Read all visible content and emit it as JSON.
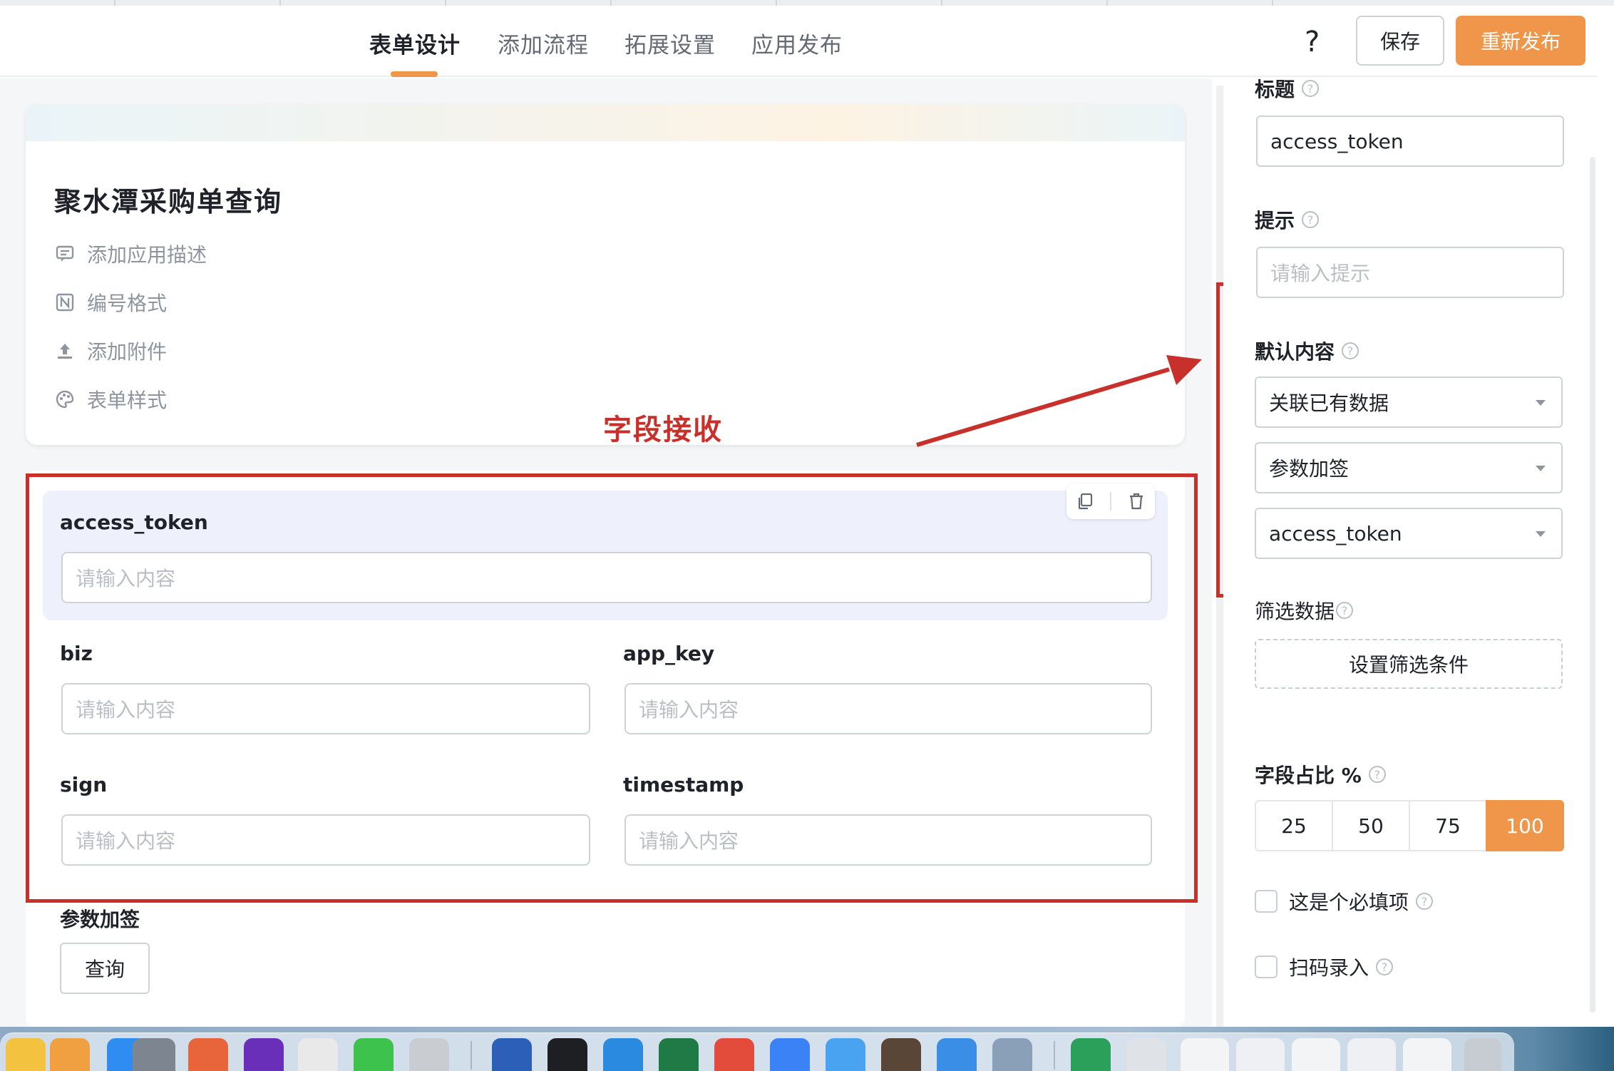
{
  "header": {
    "tabs": [
      {
        "label": "表单设计",
        "active": true
      },
      {
        "label": "添加流程",
        "active": false
      },
      {
        "label": "拓展设置",
        "active": false
      },
      {
        "label": "应用发布",
        "active": false
      }
    ],
    "help": "?",
    "save_label": "保存",
    "publish_label": "重新发布",
    "accent_color": "#f0964a"
  },
  "form": {
    "title": "聚水潭采购单查询",
    "meta": [
      {
        "icon": "comment-icon",
        "label": "添加应用描述"
      },
      {
        "icon": "numbering-icon",
        "label": "编号格式"
      },
      {
        "icon": "upload-icon",
        "label": "添加附件"
      },
      {
        "icon": "palette-icon",
        "label": "表单样式"
      }
    ]
  },
  "annotation": {
    "text": "字段接收",
    "color": "#c8312b"
  },
  "fields": {
    "access_token": {
      "label": "access_token",
      "placeholder": "请输入内容"
    },
    "biz": {
      "label": "biz",
      "placeholder": "请输入内容"
    },
    "app_key": {
      "label": "app_key",
      "placeholder": "请输入内容"
    },
    "sign": {
      "label": "sign",
      "placeholder": "请输入内容"
    },
    "timestamp": {
      "label": "timestamp",
      "placeholder": "请输入内容"
    },
    "sign_group": {
      "label": "参数加签",
      "button": "查询"
    }
  },
  "panel": {
    "title_label": "标题",
    "title_value": "access_token",
    "hint_label": "提示",
    "hint_placeholder": "请输入提示",
    "default_label": "默认内容",
    "default_selects": [
      "关联已有数据",
      "参数加签",
      "access_token"
    ],
    "filter_label": "筛选数据",
    "filter_button": "设置筛选条件",
    "ratio_label": "字段占比 %",
    "ratios": [
      "25",
      "50",
      "75",
      "100"
    ],
    "ratio_selected": "100",
    "required_label": "这是个必填项",
    "scan_label": "扫码录入"
  }
}
